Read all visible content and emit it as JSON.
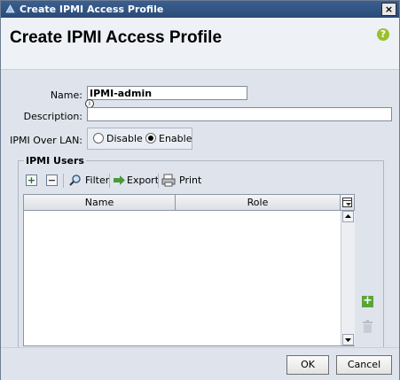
{
  "window": {
    "title": "Create IPMI Access Profile",
    "close_glyph": "×"
  },
  "header": {
    "title": "Create IPMI Access Profile",
    "help_glyph": "?"
  },
  "form": {
    "name_label": "Name:",
    "name_value": "IPMI-admin",
    "description_label": "Description:",
    "description_value": "",
    "ipmi_over_lan_label": "IPMI Over LAN:",
    "options": [
      {
        "label": "Disable",
        "selected": false
      },
      {
        "label": "Enable",
        "selected": true
      }
    ]
  },
  "users_section": {
    "legend": "IPMI Users",
    "toolbar": {
      "filter": "Filter",
      "export": "Export",
      "print": "Print"
    },
    "columns": [
      "Name",
      "Role"
    ],
    "rows": []
  },
  "buttons": {
    "ok": "OK",
    "cancel": "Cancel"
  },
  "icons": [
    "app-icon",
    "close-icon",
    "help-icon",
    "add-icon",
    "remove-icon",
    "filter-icon",
    "export-icon",
    "print-icon",
    "column-chooser-icon",
    "add-user-icon",
    "delete-icon"
  ],
  "colors": {
    "titlebar": "#2a4b79",
    "body_bg": "#dfe4ec",
    "header_bg": "#eef1f5",
    "help_green": "#9bbf2d",
    "add_green": "#5aa43a"
  }
}
